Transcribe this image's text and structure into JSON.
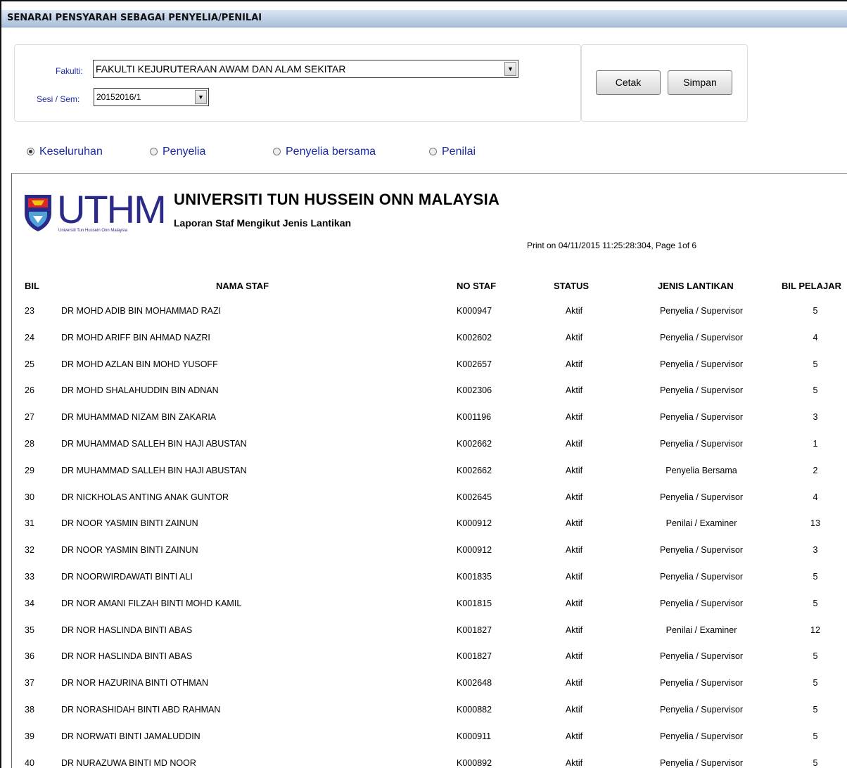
{
  "header": {
    "title": "SENARAI PENSYARAH SEBAGAI PENYELIA/PENILAI"
  },
  "filters": {
    "fakulti_label": "Fakulti:",
    "fakulti_value": "FAKULTI KEJURUTERAAN AWAM DAN ALAM SEKITAR",
    "sesi_label": "Sesi / Sem:",
    "sesi_value": "20152016/1"
  },
  "actions": {
    "cetak": "Cetak",
    "simpan": "Simpan"
  },
  "radios": [
    {
      "label": "Keseluruhan",
      "selected": true
    },
    {
      "label": "Penyelia",
      "selected": false
    },
    {
      "label": "Penyelia bersama",
      "selected": false
    },
    {
      "label": "Penilai",
      "selected": false
    }
  ],
  "report": {
    "logo_text": "UTHM",
    "logo_subtext": "Universiti Tun Hussein Onn Malaysia",
    "university": "UNIVERSITI TUN HUSSEIN ONN MALAYSIA",
    "report_title": "Laporan Staf Mengikut Jenis Lantikan",
    "print_info": "Print on 04/11/2015 11:25:28:304, Page 1of 6",
    "columns": [
      "BIL",
      "NAMA STAF",
      "NO STAF",
      "STATUS",
      "JENIS LANTIKAN",
      "BIL PELAJAR"
    ],
    "rows": [
      [
        "23",
        "DR MOHD ADIB BIN MOHAMMAD RAZI",
        "K000947",
        "Aktif",
        "Penyelia / Supervisor",
        "5"
      ],
      [
        "24",
        "DR MOHD ARIFF BIN AHMAD NAZRI",
        "K002602",
        "Aktif",
        "Penyelia / Supervisor",
        "4"
      ],
      [
        "25",
        "DR MOHD AZLAN BIN MOHD YUSOFF",
        "K002657",
        "Aktif",
        "Penyelia / Supervisor",
        "5"
      ],
      [
        "26",
        "DR MOHD SHALAHUDDIN BIN ADNAN",
        "K002306",
        "Aktif",
        "Penyelia / Supervisor",
        "5"
      ],
      [
        "27",
        "DR MUHAMMAD NIZAM BIN ZAKARIA",
        "K001196",
        "Aktif",
        "Penyelia / Supervisor",
        "3"
      ],
      [
        "28",
        "DR MUHAMMAD SALLEH BIN HAJI ABUSTAN",
        "K002662",
        "Aktif",
        "Penyelia / Supervisor",
        "1"
      ],
      [
        "29",
        "DR MUHAMMAD SALLEH BIN HAJI ABUSTAN",
        "K002662",
        "Aktif",
        "Penyelia Bersama",
        "2"
      ],
      [
        "30",
        "DR NICKHOLAS ANTING ANAK GUNTOR",
        "K002645",
        "Aktif",
        "Penyelia / Supervisor",
        "4"
      ],
      [
        "31",
        "DR NOOR YASMIN BINTI ZAINUN",
        "K000912",
        "Aktif",
        "Penilai / Examiner",
        "13"
      ],
      [
        "32",
        "DR NOOR YASMIN BINTI ZAINUN",
        "K000912",
        "Aktif",
        "Penyelia / Supervisor",
        "3"
      ],
      [
        "33",
        "DR NOORWIRDAWATI BINTI ALI",
        "K001835",
        "Aktif",
        "Penyelia / Supervisor",
        "5"
      ],
      [
        "34",
        "DR NOR AMANI FILZAH BINTI MOHD KAMIL",
        "K001815",
        "Aktif",
        "Penyelia / Supervisor",
        "5"
      ],
      [
        "35",
        "DR NOR HASLINDA BINTI ABAS",
        "K001827",
        "Aktif",
        "Penilai / Examiner",
        "12"
      ],
      [
        "36",
        "DR NOR HASLINDA BINTI ABAS",
        "K001827",
        "Aktif",
        "Penyelia / Supervisor",
        "5"
      ],
      [
        "37",
        "DR NOR HAZURINA BINTI OTHMAN",
        "K002648",
        "Aktif",
        "Penyelia / Supervisor",
        "5"
      ],
      [
        "38",
        "DR NORASHIDAH BINTI ABD RAHMAN",
        "K000882",
        "Aktif",
        "Penyelia / Supervisor",
        "5"
      ],
      [
        "39",
        "DR NORWATI BINTI JAMALUDDIN",
        "K000911",
        "Aktif",
        "Penyelia / Supervisor",
        "5"
      ],
      [
        "40",
        "DR NURAZUWA BINTI MD NOOR",
        "K000892",
        "Aktif",
        "Penyelia / Supervisor",
        "5"
      ]
    ]
  },
  "colors": {
    "title_bar": "#a9bfdb",
    "label_blue": "#1a2aa8",
    "logo_blue": "#2b2a88"
  }
}
